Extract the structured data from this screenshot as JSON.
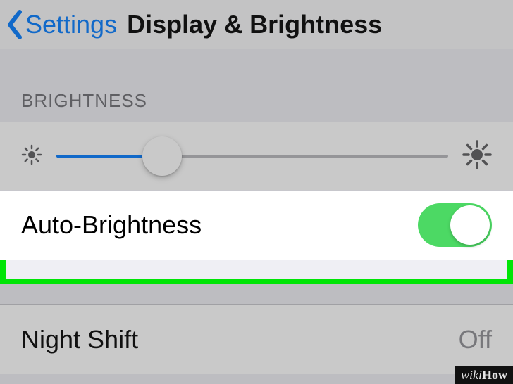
{
  "nav": {
    "back_label": "Settings",
    "title": "Display & Brightness"
  },
  "brightness": {
    "section_header": "BRIGHTNESS",
    "slider_percent": 27
  },
  "auto_brightness": {
    "label": "Auto-Brightness",
    "enabled": true
  },
  "night_shift": {
    "label": "Night Shift",
    "value": "Off"
  },
  "watermark": {
    "prefix": "wiki",
    "suffix": "How"
  },
  "colors": {
    "accent": "#007aff",
    "toggle_on": "#4cd964",
    "highlight": "#00e506"
  }
}
